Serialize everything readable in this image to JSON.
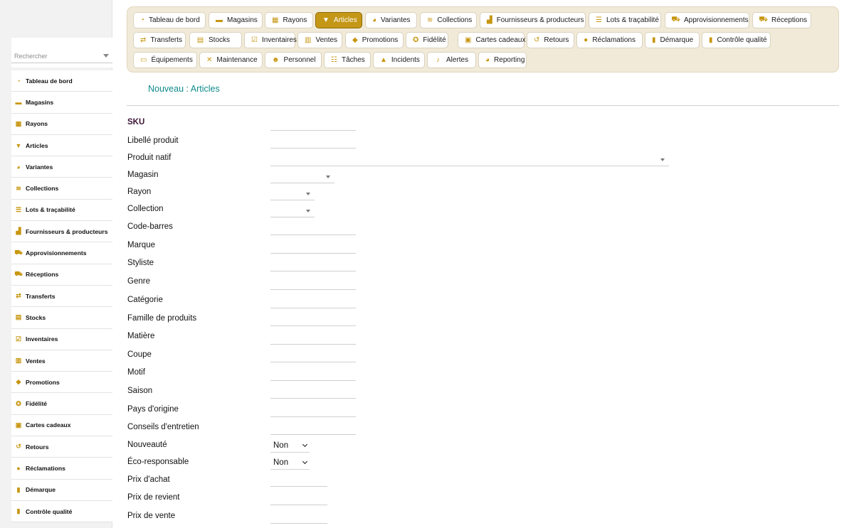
{
  "sidebar": {
    "search_placeholder": "Rechercher",
    "items": [
      {
        "label": "Tableau de bord",
        "icon": "dashboard-icon",
        "glyph": "◔"
      },
      {
        "label": "Magasins",
        "icon": "store-icon",
        "glyph": "▬"
      },
      {
        "label": "Rayons",
        "icon": "grid-icon",
        "glyph": "▦"
      },
      {
        "label": "Articles",
        "icon": "shirt-icon",
        "glyph": "▼"
      },
      {
        "label": "Variantes",
        "icon": "palette-icon",
        "glyph": "◕"
      },
      {
        "label": "Collections",
        "icon": "layers-icon",
        "glyph": "≋"
      },
      {
        "label": "Lots & traçabilité",
        "icon": "list-icon",
        "glyph": "☰"
      },
      {
        "label": "Fournisseurs & producteurs",
        "icon": "industry-icon",
        "glyph": "▟"
      },
      {
        "label": "Approvisionnements",
        "icon": "cart-icon",
        "glyph": "⛟"
      },
      {
        "label": "Réceptions",
        "icon": "truck-icon",
        "glyph": "⛟"
      },
      {
        "label": "Transferts",
        "icon": "transfer-icon",
        "glyph": "⇄"
      },
      {
        "label": "Stocks",
        "icon": "boxes-icon",
        "glyph": "▤"
      },
      {
        "label": "Inventaires",
        "icon": "clipboard-check-icon",
        "glyph": "☑"
      },
      {
        "label": "Ventes",
        "icon": "cash-register-icon",
        "glyph": "▥"
      },
      {
        "label": "Promotions",
        "icon": "tags-icon",
        "glyph": "◆"
      },
      {
        "label": "Fidélité",
        "icon": "award-icon",
        "glyph": "✪"
      },
      {
        "label": "Cartes cadeaux",
        "icon": "gift-icon",
        "glyph": "▣"
      },
      {
        "label": "Retours",
        "icon": "undo-icon",
        "glyph": "↺"
      },
      {
        "label": "Réclamations",
        "icon": "comment-icon",
        "glyph": "●"
      },
      {
        "label": "Démarque",
        "icon": "trash-icon",
        "glyph": "▮"
      },
      {
        "label": "Contrôle qualité",
        "icon": "clipboard-icon",
        "glyph": "▮"
      }
    ]
  },
  "toolbar": {
    "rows": [
      [
        {
          "label": "Tableau de bord",
          "icon": "dashboard-icon",
          "glyph": "◔",
          "active": false
        },
        {
          "label": "Magasins",
          "icon": "store-icon",
          "glyph": "▬",
          "active": false
        },
        {
          "label": "Rayons",
          "icon": "grid-icon",
          "glyph": "▦",
          "active": false
        },
        {
          "label": "Articles",
          "icon": "shirt-icon",
          "glyph": "▼",
          "active": true
        },
        {
          "label": "Variantes",
          "icon": "palette-icon",
          "glyph": "◕",
          "active": false
        },
        {
          "label": "Collections",
          "icon": "layers-icon",
          "glyph": "≋",
          "active": false
        },
        {
          "label": "Fournisseurs & producteurs",
          "icon": "industry-icon",
          "glyph": "▟",
          "active": false
        },
        {
          "label": "Lots & traçabilité",
          "icon": "list-icon",
          "glyph": "☰",
          "active": false
        },
        {
          "label": "Approvisionnements",
          "icon": "cart-icon",
          "glyph": "⛟",
          "active": false
        },
        {
          "label": "Réceptions",
          "icon": "truck-icon",
          "glyph": "⛟",
          "active": false
        }
      ],
      [
        {
          "label": "Transferts",
          "icon": "transfer-icon",
          "glyph": "⇄",
          "active": false
        },
        {
          "label": "Stocks",
          "icon": "boxes-icon",
          "glyph": "▤",
          "active": false
        },
        {
          "label": "Inventaires",
          "icon": "clipboard-check-icon",
          "glyph": "☑",
          "active": false
        },
        {
          "label": "Ventes",
          "icon": "cash-register-icon",
          "glyph": "▥",
          "active": false
        },
        {
          "label": "Promotions",
          "icon": "tags-icon",
          "glyph": "◆",
          "active": false
        },
        {
          "label": "Fidélité",
          "icon": "award-icon",
          "glyph": "✪",
          "active": false
        },
        {
          "label": "Cartes cadeaux",
          "icon": "gift-icon",
          "glyph": "▣",
          "active": false
        },
        {
          "label": "Retours",
          "icon": "undo-icon",
          "glyph": "↺",
          "active": false
        },
        {
          "label": "Réclamations",
          "icon": "comment-icon",
          "glyph": "●",
          "active": false
        },
        {
          "label": "Démarque",
          "icon": "trash-icon",
          "glyph": "▮",
          "active": false
        },
        {
          "label": "Contrôle qualité",
          "icon": "clipboard-icon",
          "glyph": "▮",
          "active": false
        }
      ],
      [
        {
          "label": "Équipements",
          "icon": "monitor-icon",
          "glyph": "▭",
          "active": false
        },
        {
          "label": "Maintenance",
          "icon": "tools-icon",
          "glyph": "✕",
          "active": false
        },
        {
          "label": "Personnel",
          "icon": "users-icon",
          "glyph": "☻",
          "active": false
        },
        {
          "label": "Tâches",
          "icon": "tasks-icon",
          "glyph": "☷",
          "active": false
        },
        {
          "label": "Incidents",
          "icon": "warning-icon",
          "glyph": "▲",
          "active": false
        },
        {
          "label": "Alertes",
          "icon": "bell-icon",
          "glyph": "♪",
          "active": false
        },
        {
          "label": "Reporting",
          "icon": "pie-chart-icon",
          "glyph": "◕",
          "active": false
        }
      ]
    ]
  },
  "main": {
    "title": "Nouveau : Articles",
    "fields": [
      {
        "label": "SKU",
        "kind": "text",
        "value": ""
      },
      {
        "label": "Libellé produit",
        "kind": "text",
        "value": ""
      },
      {
        "label": "Produit natif",
        "kind": "select",
        "value": ""
      },
      {
        "label": "Magasin",
        "kind": "select",
        "value": ""
      },
      {
        "label": "Rayon",
        "kind": "select",
        "value": ""
      },
      {
        "label": "Collection",
        "kind": "select",
        "value": ""
      },
      {
        "label": "Code-barres",
        "kind": "text",
        "value": ""
      },
      {
        "label": "Marque",
        "kind": "text",
        "value": ""
      },
      {
        "label": "Styliste",
        "kind": "text",
        "value": ""
      },
      {
        "label": "Genre",
        "kind": "text",
        "value": ""
      },
      {
        "label": "Catégorie",
        "kind": "text",
        "value": ""
      },
      {
        "label": "Famille de produits",
        "kind": "text",
        "value": ""
      },
      {
        "label": "Matière",
        "kind": "text",
        "value": ""
      },
      {
        "label": "Coupe",
        "kind": "text",
        "value": ""
      },
      {
        "label": "Motif",
        "kind": "text",
        "value": ""
      },
      {
        "label": "Saison",
        "kind": "text",
        "value": ""
      },
      {
        "label": "Pays d'origine",
        "kind": "text",
        "value": ""
      },
      {
        "label": "Conseils d'entretien",
        "kind": "text",
        "value": ""
      },
      {
        "label": "Nouveauté",
        "kind": "native-select",
        "value": "Non"
      },
      {
        "label": "Éco-responsable",
        "kind": "native-select",
        "value": "Non"
      },
      {
        "label": "Prix d'achat",
        "kind": "number",
        "value": ""
      },
      {
        "label": "Prix de revient",
        "kind": "number",
        "value": ""
      },
      {
        "label": "Prix de vente",
        "kind": "number",
        "value": ""
      }
    ]
  },
  "colors": {
    "accent": "#c49716",
    "toolbar_bg": "#f1ead8",
    "title": "#0f8a8a",
    "required_label": "#3d1538"
  }
}
